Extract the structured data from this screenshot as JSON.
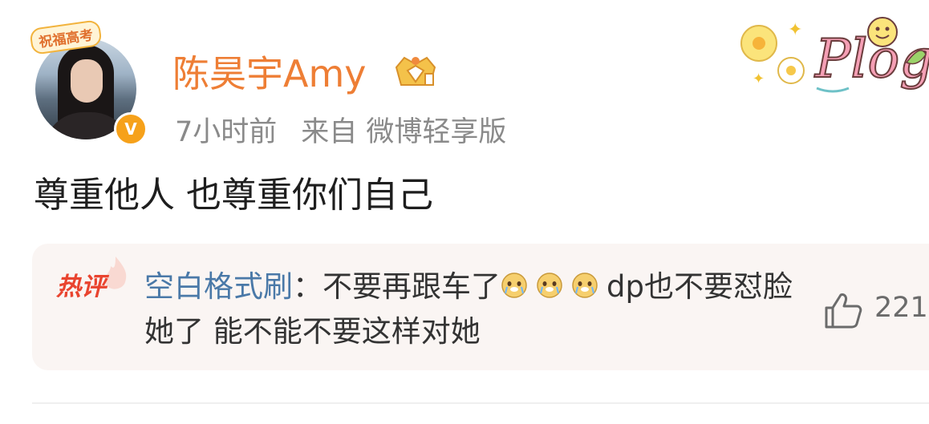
{
  "avatar": {
    "badge_text": "祝福高考"
  },
  "user": {
    "name": "陈昊宇Amy"
  },
  "meta": {
    "time": "7小时前",
    "source": "来自 微博轻享版"
  },
  "post": {
    "text": "尊重他人 也尊重你们自己"
  },
  "hot_comment": {
    "tag": "热评",
    "commenter": "空白格式刷",
    "separator": "：",
    "text_part1": "不要再跟车了",
    "text_part2": "dp也不要怼脸她了 能不能不要这样对她",
    "like_count": "221"
  },
  "colors": {
    "username": "#ee7e35",
    "commenter": "#4a79a8",
    "hot_tag": "#e9442f",
    "meta": "#8a8a8a",
    "card_bg": "#faf5f3"
  },
  "icons": [
    "crown-badge-icon",
    "verified-v-icon",
    "plog-sticker",
    "flame-icon",
    "crying-dog-emoji",
    "thumbs-up-icon"
  ]
}
